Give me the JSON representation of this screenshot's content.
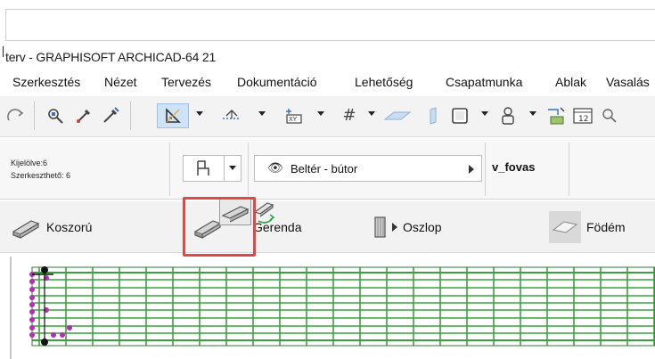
{
  "window": {
    "title": "terv - GRAPHISOFT ARCHICAD-64 21"
  },
  "menu": {
    "items": [
      "Szerkesztés",
      "Nézet",
      "Tervezés",
      "Dokumentáció",
      "Lehetőség",
      "Csapatmunka",
      "Ablak",
      "Vasalás"
    ]
  },
  "info": {
    "selected": "Kijelölve:6",
    "editable": "Szerkeszthető: 6",
    "layer": "Beltér - bútor",
    "element_id": "v_fovas"
  },
  "tools": {
    "koszoru": "Koszorú",
    "gerenda": "Gerenda",
    "oszlop": "Oszlop",
    "fodem": "Födém"
  },
  "toolbar": {
    "label_12": "12",
    "label_xy": "XY"
  },
  "colors": {
    "highlight": "#e04848",
    "grid_green": "#3aa23a",
    "node_purple": "#b12fb1"
  }
}
